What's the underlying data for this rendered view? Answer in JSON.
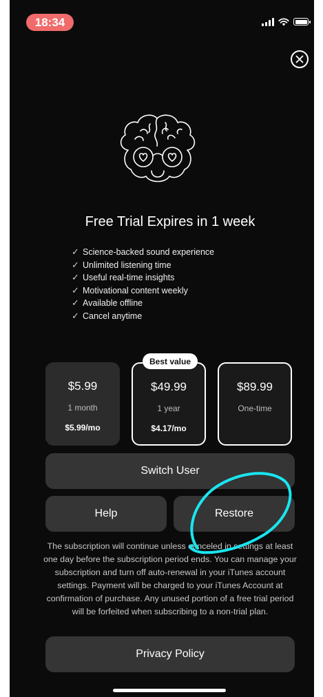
{
  "status_bar": {
    "time": "18:34"
  },
  "title": "Free Trial Expires in 1 week",
  "features": [
    "Science-backed sound experience",
    "Unlimited listening time",
    "Useful real-time insights",
    "Motivational content weekly",
    "Available offline",
    "Cancel anytime"
  ],
  "plans": [
    {
      "price": "$5.99",
      "period": "1 month",
      "per_month": "$5.99/mo"
    },
    {
      "price": "$49.99",
      "period": "1 year",
      "per_month": "$4.17/mo",
      "badge": "Best value"
    },
    {
      "price": "$89.99",
      "period": "One-time",
      "per_month": ""
    }
  ],
  "buttons": {
    "switch_user": "Switch User",
    "help": "Help",
    "restore": "Restore",
    "privacy_policy": "Privacy Policy"
  },
  "legal_text": "The subscription will continue unless canceled in settings at least one day before the subscription period ends. You can manage your subscription and turn off auto-renewal in your iTunes account settings. Payment will be charged to your iTunes Account at confirmation of purchase. Any unused portion of a free trial period will be forfeited when subscribing to a non-trial plan.",
  "colors": {
    "background": "#0b0b0b",
    "time_pill": "#f06b6b",
    "button": "#353535",
    "annotation": "#19e6f0"
  },
  "icons": {
    "close": "close-circle-icon",
    "hero": "brain-with-heart-glasses-icon",
    "check": "check-icon"
  }
}
